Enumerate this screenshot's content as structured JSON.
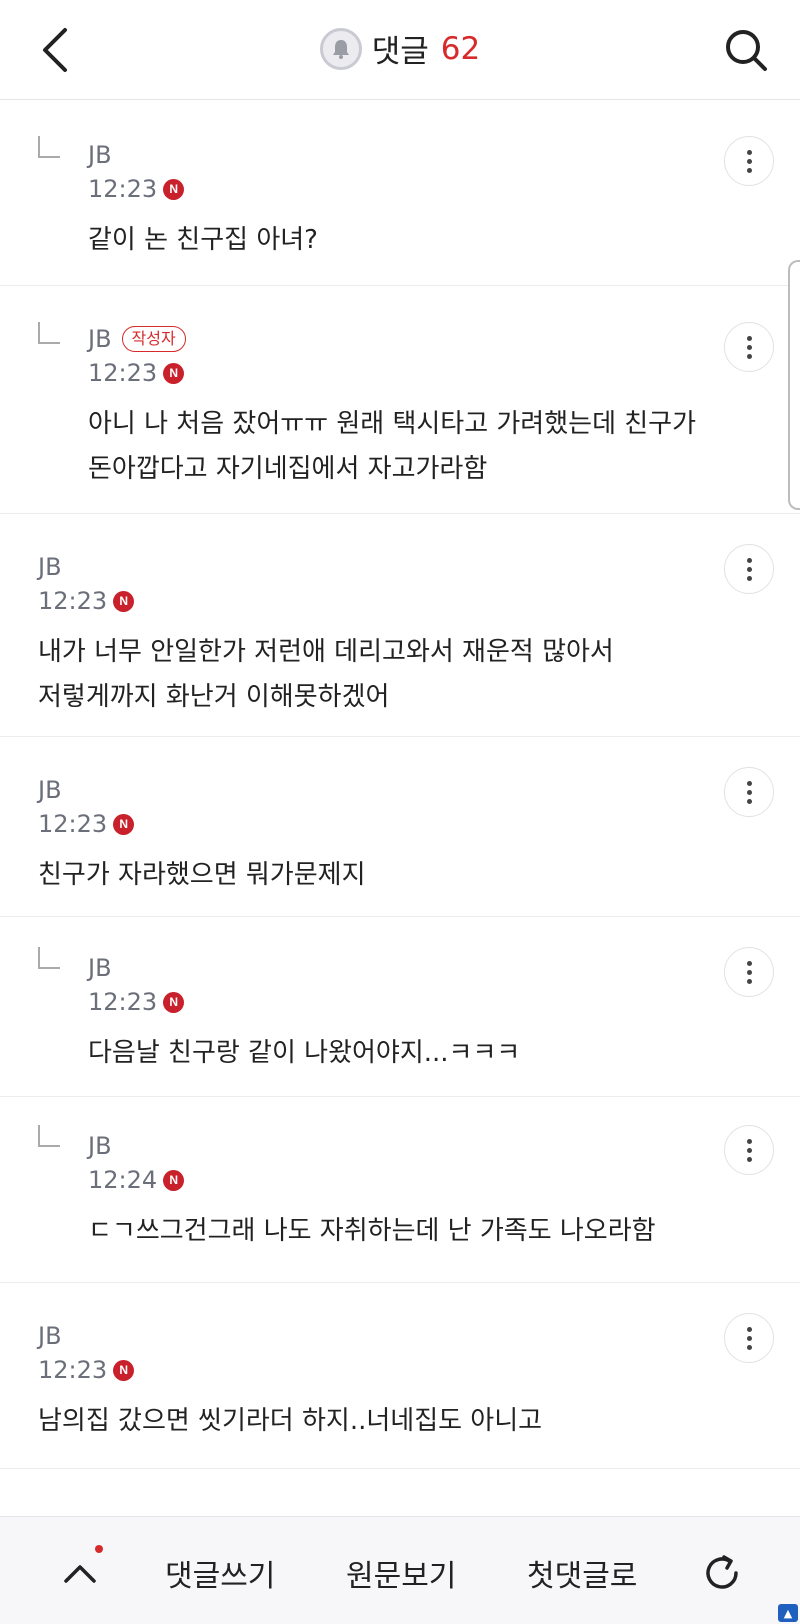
{
  "header": {
    "back_icon": "chevron-left-icon",
    "bell_icon": "bell-icon",
    "title": "댓글",
    "count": "62",
    "search_icon": "search-icon",
    "count_color": "#d72b2b"
  },
  "comments": [
    {
      "reply": true,
      "author": "JB",
      "author_badge": "",
      "time": "12:23",
      "new_badge": "N",
      "lines": [
        "같이 논 친구집 아녀?"
      ]
    },
    {
      "reply": true,
      "author": "JB",
      "author_badge": "작성자",
      "time": "12:23",
      "new_badge": "N",
      "lines": [
        "아니 나 처음 잤어ㅠㅠ 원래 택시타고 가려했는데 친구가",
        "돈아깝다고 자기네집에서 자고가라함"
      ]
    },
    {
      "reply": false,
      "author": "JB",
      "author_badge": "",
      "time": "12:23",
      "new_badge": "N",
      "lines": [
        "내가 너무 안일한가 저런애 데리고와서 재운적 많아서",
        "저렇게까지 화난거 이해못하겠어"
      ]
    },
    {
      "reply": false,
      "author": "JB",
      "author_badge": "",
      "time": "12:23",
      "new_badge": "N",
      "lines": [
        "친구가 자라했으면 뭐가문제지"
      ]
    },
    {
      "reply": true,
      "author": "JB",
      "author_badge": "",
      "time": "12:23",
      "new_badge": "N",
      "lines": [
        "다음날 친구랑 같이 나왔어야지...ㅋㅋㅋ"
      ]
    },
    {
      "reply": true,
      "author": "JB",
      "author_badge": "",
      "time": "12:24",
      "new_badge": "N",
      "lines": [
        "ㄷㄱ쓰그건그래 나도 자취하는데 난 가족도 나오라함"
      ]
    },
    {
      "reply": false,
      "author": "JB",
      "author_badge": "",
      "time": "12:23",
      "new_badge": "N",
      "lines": [
        "남의집 갔으면 씻기라더 하지..너네집도 아니고"
      ]
    }
  ],
  "bottom_bar": {
    "up_icon": "chevron-up-icon",
    "write_label": "댓글쓰기",
    "original_label": "원문보기",
    "first_label": "첫댓글로",
    "refresh_icon": "refresh-icon"
  }
}
